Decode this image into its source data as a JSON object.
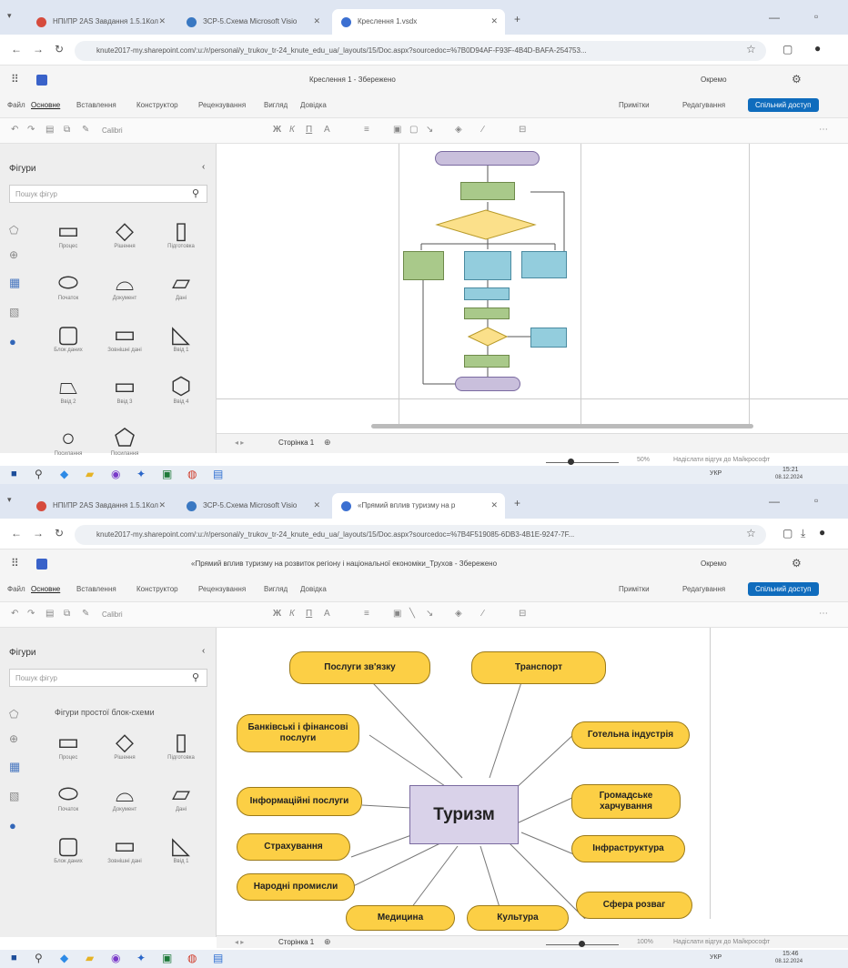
{
  "shot1": {
    "tabs": [
      {
        "label": "НПІ/ПР 2AS Завдання 1.5.1Кол"
      },
      {
        "label": "ЗСР-5.Схема Microsoft Visio"
      },
      {
        "label": "Креслення 1.vsdx"
      }
    ],
    "url": "knute2017-my.sharepoint.com/:u:/r/personal/y_trukov_tr-24_knute_edu_ua/_layouts/15/Doc.aspx?sourcedoc=%7B0D94AF-F93F-4B4D-BAFA-254753...",
    "doc_title": "Креслення 1 - Збережено",
    "comments": "Окремо",
    "menu": [
      "Файл",
      "Основне",
      "Вставлення",
      "Конструктор",
      "Рецензування",
      "Вигляд",
      "Довідка"
    ],
    "btn_comments": "Примітки",
    "btn_edit": "Редагування",
    "btn_share": "Спільний доступ",
    "font": "Calibri",
    "panel_title": "Фігури",
    "search_placeholder": "Пошук фігур",
    "shape_labels": [
      "Процес",
      "Рішення",
      "Підготовка",
      "Початок",
      "Документ",
      "Дані",
      "Блок даних",
      "Зовнішні дані",
      "Ввід 1",
      "Ввід 2",
      "Ввід 3",
      "Ввід 4",
      "Посилання",
      "Посилання"
    ],
    "sheet_tab": "Сторінка 1",
    "zoom": "50%",
    "zoom_hint": "Надіслати відгук до Майкрософт",
    "clock_time": "15:21",
    "clock_date": "08.12.2024",
    "lang": "УКР"
  },
  "shot2": {
    "tabs": [
      {
        "label": "НПІ/ПР 2AS Завдання 1.5.1Кол"
      },
      {
        "label": "ЗСР-5.Схема Microsoft Visio"
      },
      {
        "label": "«Прямий вплив туризму на р"
      }
    ],
    "url": "knute2017-my.sharepoint.com/:u:/r/personal/y_trukov_tr-24_knute_edu_ua/_layouts/15/Doc.aspx?sourcedoc=%7B4F519085-6DB3-4B1E-9247-7F...",
    "doc_title": "«Прямий вплив туризму на розвиток регіону і національної економіки_Трухов - Збережено",
    "comments": "Окремо",
    "menu": [
      "Файл",
      "Основне",
      "Вставлення",
      "Конструктор",
      "Рецензування",
      "Вигляд",
      "Довідка"
    ],
    "btn_comments": "Примітки",
    "btn_edit": "Редагування",
    "btn_share": "Спільний доступ",
    "font": "Calibri",
    "panel_title": "Фігури",
    "search_placeholder": "Пошук фігур",
    "stencil_title": "Фігури простої блок-схеми",
    "shape_labels": [
      "Процес",
      "Рішення",
      "Підготовка",
      "Початок",
      "Документ",
      "Дані",
      "Блок даних",
      "Зовнішні дані",
      "Ввід 1"
    ],
    "center_label": "Туризм",
    "nodes": [
      "Послуги зв'язку",
      "Транспорт",
      "Банківські і фінансові послуги",
      "Готельна індустрія",
      "Інформаційні послуги",
      "Громадське харчування",
      "Інфраструктура",
      "Страхування",
      "Народні промисли",
      "Сфера розваг",
      "Медицина",
      "Культура"
    ],
    "sheet_tab": "Сторінка 1",
    "zoom": "100%",
    "zoom_hint": "Надіслати відгук до Майкрософт",
    "clock_time": "15:46",
    "clock_date": "08.12.2024",
    "lang": "УКР"
  },
  "colors": {
    "mind_node_fill": "#fccf45",
    "center_fill": "#d9d2e9",
    "flow_green": "#a9c98a",
    "flow_blue": "#93cddd",
    "flow_diamond": "#fbe08a",
    "flow_terminal": "#c9bfdc",
    "share_button": "#0f6cbd"
  }
}
